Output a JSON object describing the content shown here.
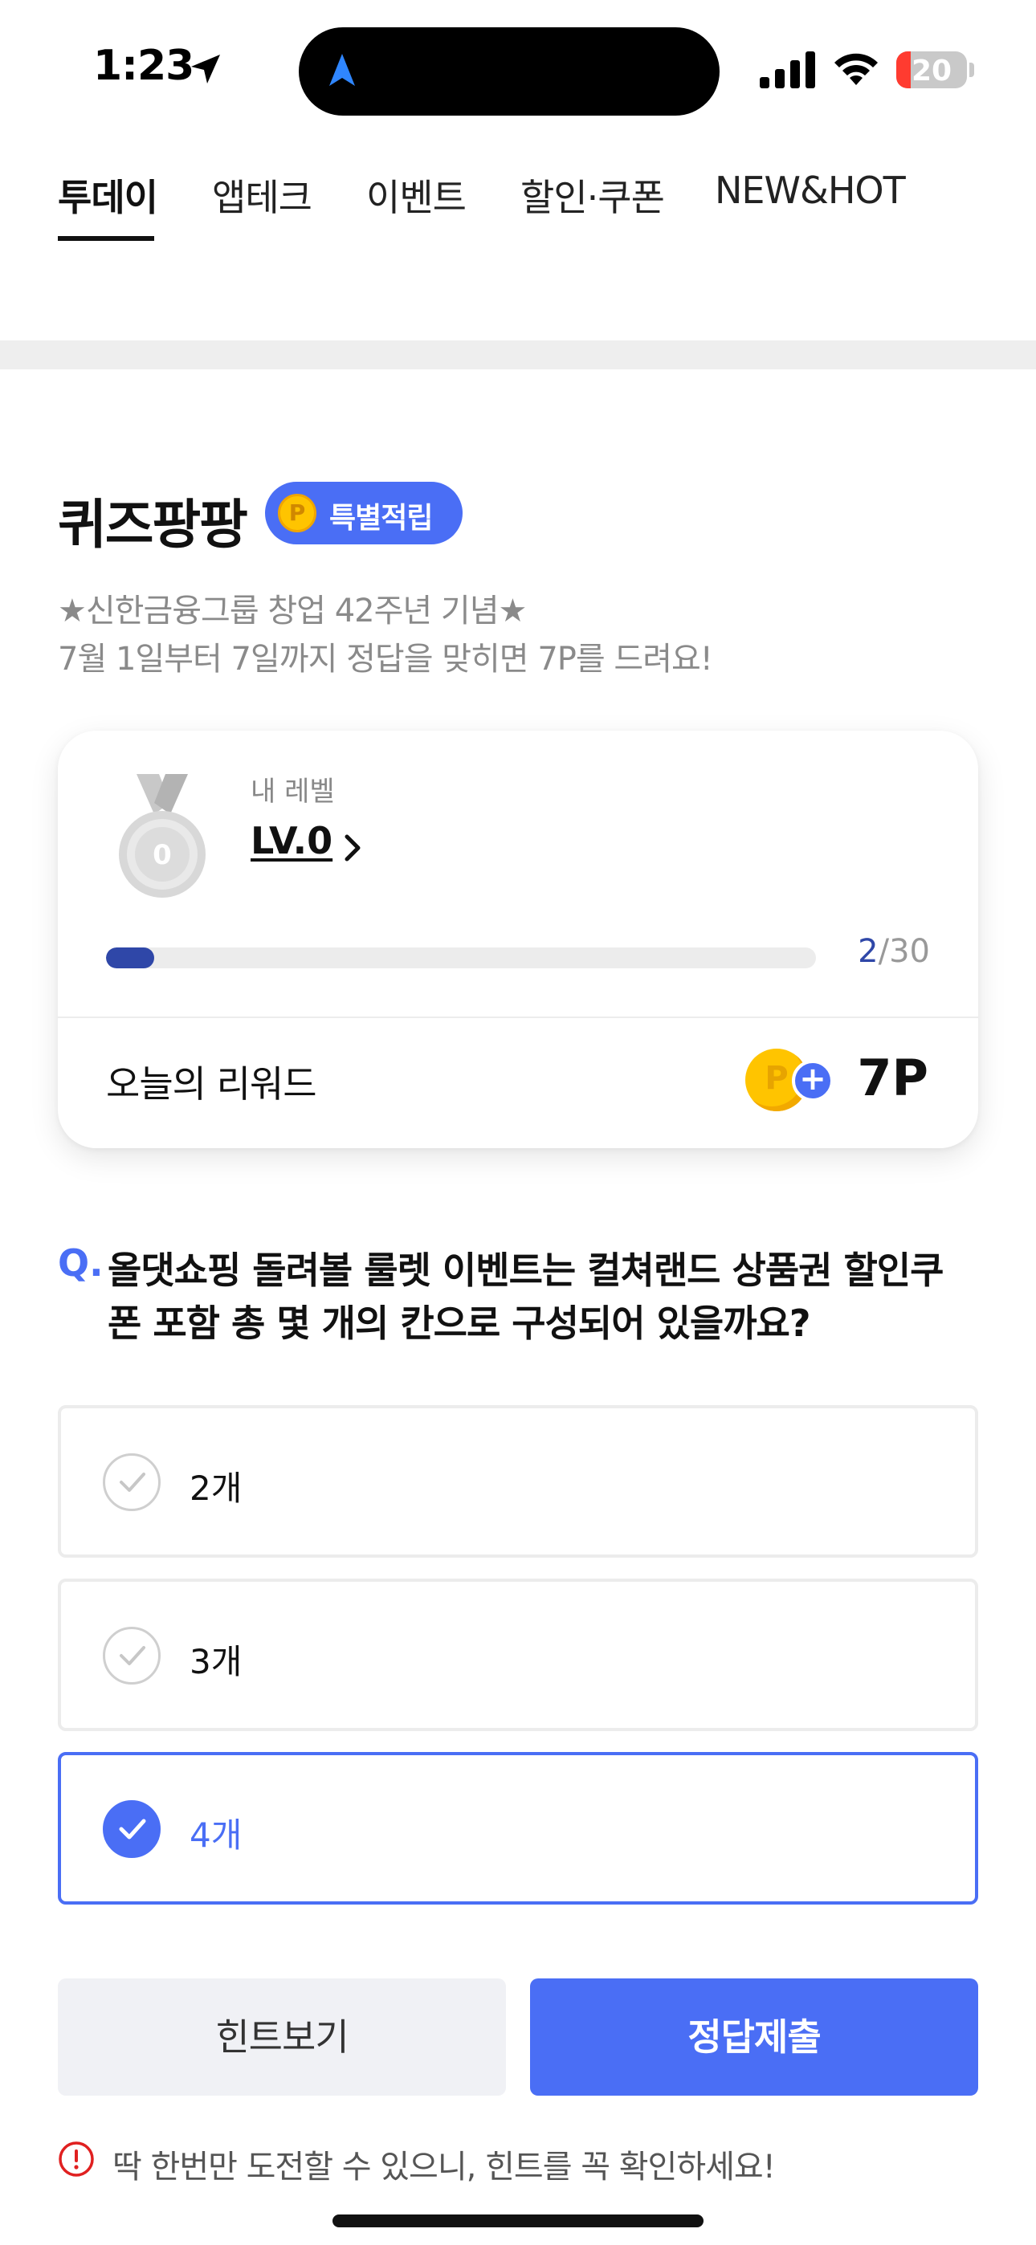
{
  "status_bar": {
    "time": "1:23",
    "battery_level": "20",
    "battery_fraction": 0.2
  },
  "tabs": [
    {
      "label": "투데이",
      "active": true
    },
    {
      "label": "앱테크",
      "active": false
    },
    {
      "label": "이벤트",
      "active": false
    },
    {
      "label": "할인·쿠폰",
      "active": false
    },
    {
      "label": "NEW&HOT",
      "active": false
    }
  ],
  "quiz": {
    "title": "퀴즈팡팡",
    "badge_label": "특별적립",
    "badge_coin": "P",
    "subtitle_line1": "★신한금융그룹 창업 42주년 기념★",
    "subtitle_line2": "7월 1일부터 7일까지 정답을 맞히면 7P를 드려요!"
  },
  "level_card": {
    "caption": "내 레벨",
    "level": "LV.0",
    "medal_number": "0",
    "progress_current": "2",
    "progress_total": "/30",
    "progress_fraction": 0.067,
    "reward_label": "오늘의 리워드",
    "reward_coin": "P",
    "reward_plus": "+",
    "reward_value": "7P"
  },
  "question": {
    "marker": "Q.",
    "line1": "올댓쇼핑 돌려볼 룰렛 이벤트는 컬쳐랜드 상품권 할인쿠",
    "line2": "폰 포함 총 몇 개의 칸으로 구성되어 있을까요?"
  },
  "options": [
    {
      "label": "2개",
      "selected": false
    },
    {
      "label": "3개",
      "selected": false
    },
    {
      "label": "4개",
      "selected": true
    }
  ],
  "buttons": {
    "hint_label": "힌트보기",
    "submit_label": "정답제출"
  },
  "notice": {
    "icon": "alert-circle-icon",
    "text": "딱 한번만 도전할 수 있으니, 힌트를 꼭 확인하세요!"
  },
  "colors": {
    "accent": "#4a6ef5",
    "progress": "#2f47a8",
    "alert": "#e02020",
    "coin": "#ffc400"
  }
}
